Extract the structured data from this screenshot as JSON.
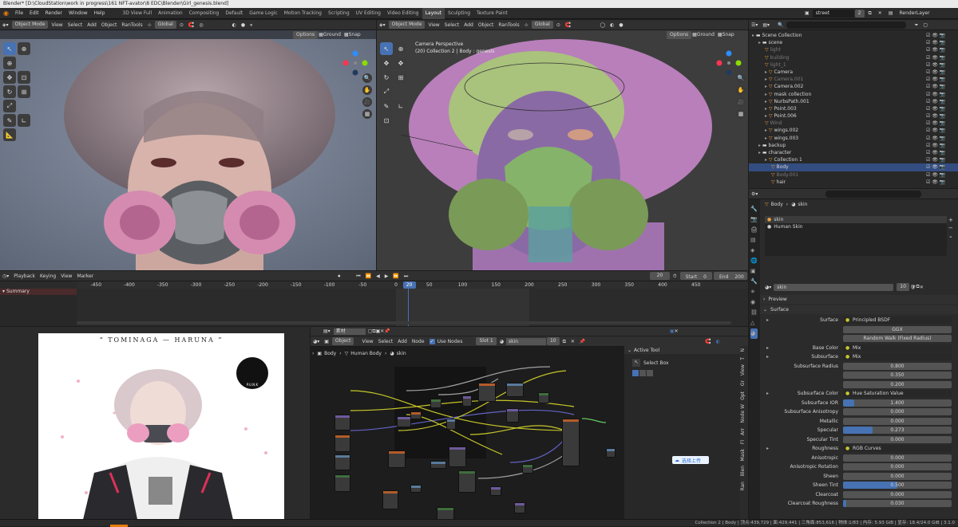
{
  "window": {
    "title": "Blender* [D:\\CloudStation\\work in progress\\161 NFT-avator\\8 EDC\\Blender\\Girl_genesis.blend]"
  },
  "menu": [
    "File",
    "Edit",
    "Render",
    "Window",
    "Help"
  ],
  "workspaces": [
    "3D View Full",
    "Animation",
    "Compositing",
    "Default",
    "Game Logic",
    "Motion Tracking",
    "Scripting",
    "UV Editing",
    "Video Editing",
    "Layout",
    "Sculpting",
    "Texture Paint"
  ],
  "active_workspace": "Layout",
  "scene": {
    "name": "street",
    "count": "2",
    "view_layer": "RenderLayer"
  },
  "viewport_left": {
    "mode": "Object Mode",
    "menus": [
      "View",
      "Select",
      "Add",
      "Object",
      "RanTools"
    ],
    "orientation": "Global",
    "options": "Options",
    "ground": "Ground",
    "snap": "Snap"
  },
  "viewport_right": {
    "mode": "Object Mode",
    "menus": [
      "View",
      "Select",
      "Add",
      "Object",
      "RanTools"
    ],
    "orientation": "Global",
    "options": "Options",
    "ground": "Ground",
    "snap": "Snap",
    "overlay_line1": "Camera Perspective",
    "overlay_line2": "(20) Collection 2 | Body : genesis"
  },
  "outliner": {
    "rows": [
      {
        "label": "Scene Collection",
        "indent": 0
      },
      {
        "label": "scene",
        "indent": 1
      },
      {
        "label": "light",
        "indent": 2,
        "dim": true
      },
      {
        "label": "building",
        "indent": 2,
        "dim": true
      },
      {
        "label": "light_1",
        "indent": 2,
        "dim": true
      },
      {
        "label": "Camera",
        "indent": 2
      },
      {
        "label": "Camera.001",
        "indent": 2,
        "dim": true
      },
      {
        "label": "Camera.002",
        "indent": 2
      },
      {
        "label": "mask collection",
        "indent": 2
      },
      {
        "label": "NurbsPath.001",
        "indent": 2
      },
      {
        "label": "Point.003",
        "indent": 2
      },
      {
        "label": "Point.006",
        "indent": 2
      },
      {
        "label": "Wind",
        "indent": 2,
        "dim": true
      },
      {
        "label": "wings.002",
        "indent": 2
      },
      {
        "label": "wings.003",
        "indent": 2
      },
      {
        "label": "backup",
        "indent": 1
      },
      {
        "label": "character",
        "indent": 1
      },
      {
        "label": "Collection 1",
        "indent": 2
      },
      {
        "label": "Body",
        "indent": 3,
        "sel": true
      },
      {
        "label": "Body.001",
        "indent": 3,
        "dim": true
      },
      {
        "label": "hair",
        "indent": 3
      }
    ]
  },
  "properties": {
    "breadcrumb_obj": "Body",
    "breadcrumb_mat": "skin",
    "slots": [
      "skin",
      "Human Skin"
    ],
    "material_name": "skin",
    "users": "10",
    "preview": "Preview",
    "surface": "Surface",
    "rows": [
      {
        "label": "Surface",
        "value": "Principled BSDF",
        "type": "socket"
      },
      {
        "label": "",
        "value": "GGX",
        "type": "enum"
      },
      {
        "label": "",
        "value": "Random Walk (Fixed Radius)",
        "type": "enum"
      },
      {
        "label": "Base Color",
        "value": "Mix",
        "type": "socket"
      },
      {
        "label": "Subsurface",
        "value": "Mix",
        "type": "socket"
      },
      {
        "label": "Subsurface Radius",
        "value": "0.800",
        "type": "num"
      },
      {
        "label": "",
        "value": "0.350",
        "type": "num"
      },
      {
        "label": "",
        "value": "0.200",
        "type": "num"
      },
      {
        "label": "Subsurface Color",
        "value": "Hue Saturation Value",
        "type": "socket"
      },
      {
        "label": "Subsurface IOR",
        "value": "1.400",
        "type": "slider",
        "fill": 0.1
      },
      {
        "label": "Subsurface Anisotropy",
        "value": "0.000",
        "type": "num"
      },
      {
        "label": "Metallic",
        "value": "0.000",
        "type": "num"
      },
      {
        "label": "Specular",
        "value": "0.273",
        "type": "slider",
        "fill": 0.273
      },
      {
        "label": "Specular Tint",
        "value": "0.000",
        "type": "num"
      },
      {
        "label": "Roughness",
        "value": "RGB Curves",
        "type": "socket"
      },
      {
        "label": "Anisotropic",
        "value": "0.000",
        "type": "num"
      },
      {
        "label": "Anisotropic Rotation",
        "value": "0.000",
        "type": "num"
      },
      {
        "label": "Sheen",
        "value": "0.000",
        "type": "num"
      },
      {
        "label": "Sheen Tint",
        "value": "0.500",
        "type": "slider",
        "fill": 0.5
      },
      {
        "label": "Clearcoat",
        "value": "0.000",
        "type": "num"
      },
      {
        "label": "Clearcoat Roughness",
        "value": "0.030",
        "type": "slider",
        "fill": 0.03
      }
    ]
  },
  "timeline": {
    "menus": [
      "Playback",
      "Keying",
      "View",
      "Marker"
    ],
    "current_frame": "20",
    "start_label": "Start",
    "start": "0",
    "end_label": "End",
    "end": "200",
    "summary": "Summary",
    "ruler": [
      "-450",
      "-400",
      "-350",
      "-300",
      "-250",
      "-200",
      "-150",
      "-100",
      "-50",
      "0",
      "20",
      "50",
      "100",
      "150",
      "200",
      "250",
      "300",
      "350",
      "400",
      "450"
    ]
  },
  "image_editor": {
    "poster_title": "“  TOMINAGA — HARUNA  ”",
    "logo_text": "P.U.N.K"
  },
  "node_editor": {
    "header_name": "素材",
    "object": "Object",
    "menus": [
      "View",
      "Select",
      "Add",
      "Node"
    ],
    "use_nodes": "Use Nodes",
    "slot": "Slot 1",
    "material": "skin",
    "users": "10",
    "breadcrumb": [
      "Body",
      "Human Body",
      "skin"
    ],
    "active_tool": "Active Tool",
    "select_box": "Select Box",
    "upload_btn": "选择上传",
    "side_tabs": [
      "N",
      "T",
      "View",
      "Gr",
      "Opt",
      "Node W",
      "Arr",
      "Fl",
      "Mask",
      "Blen",
      "Ran"
    ]
  },
  "statusbar": {
    "text": "Collection 2 | Body | 顶点:439,729 | 面:429,441 | 三角面:853,616 | 物体:1/83 | 内存: 5.93 GiB | 显存: 18.4/24.0 GiB | 3.1.0"
  },
  "colors": {
    "accent": "#4772b3",
    "header": "#303030",
    "panel": "#2b2b2b",
    "viewport_bg": "#3d3d3d"
  }
}
